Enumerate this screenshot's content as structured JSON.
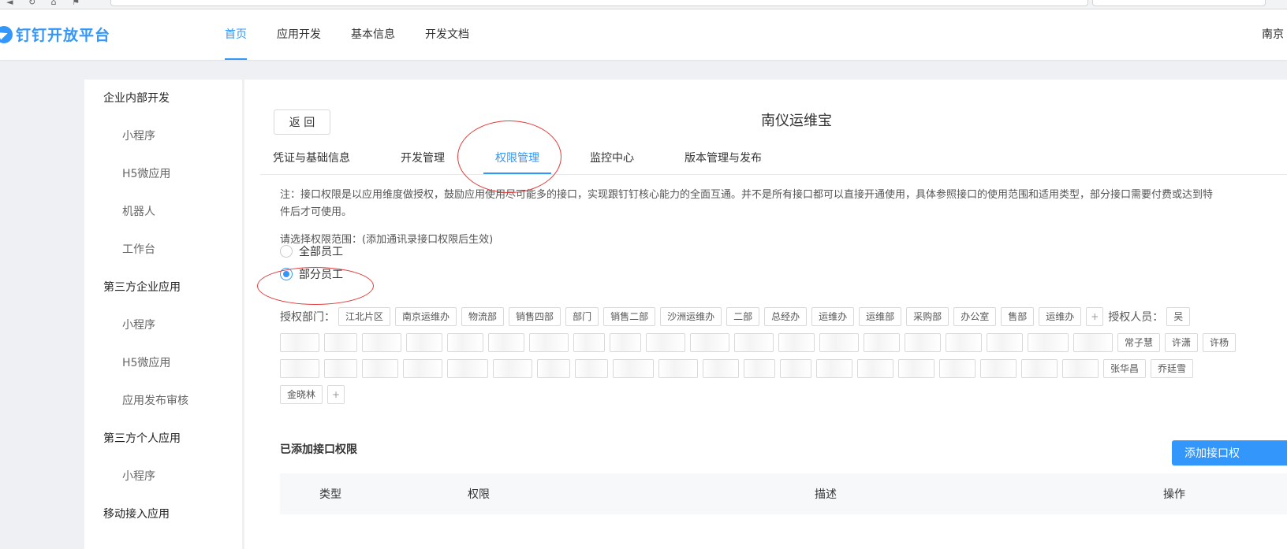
{
  "header": {
    "logo_text": "钉钉开放平台",
    "nav": [
      "首页",
      "应用开发",
      "基本信息",
      "开发文档"
    ],
    "active_nav": "首页",
    "user_text": "南京"
  },
  "sidebar": {
    "groups": [
      {
        "title": "企业内部开发",
        "items": [
          "小程序",
          "H5微应用",
          "机器人",
          "工作台"
        ]
      },
      {
        "title": "第三方企业应用",
        "items": [
          "小程序",
          "H5微应用",
          "应用发布审核"
        ]
      },
      {
        "title": "第三方个人应用",
        "items": [
          "小程序"
        ]
      },
      {
        "title": "移动接入应用",
        "items": []
      }
    ]
  },
  "main": {
    "back_label": "返 回",
    "app_title": "南仪运维宝",
    "tabs": [
      "凭证与基础信息",
      "开发管理",
      "权限管理",
      "监控中心",
      "版本管理与发布"
    ],
    "active_tab": "权限管理",
    "note_line1": "注：接口权限是以应用维度做授权，鼓励应用使用尽可能多的接口，实现跟钉钉核心能力的全面互通。并不是所有接口都可以直接开通使用，具体参照接口的使用范围和适用类型，部分接口需要付费或达到特",
    "note_line2": "件后才可使用。",
    "scope_label": "请选择权限范围：(添加通讯录接口权限后生效)",
    "radio_all": "全部员工",
    "radio_partial": "部分员工",
    "radio_selected": "部分员工",
    "auth_dept_label": "授权部门：",
    "auth_person_label": "授权人员：",
    "dept_chips_visible": [
      "江北片区",
      "南京运维办",
      "物流部",
      "销售四部",
      "部门",
      "销售二部",
      "沙洲运维办",
      "二部",
      "总经办",
      "运维办",
      "运维部",
      "采购部",
      "办公室",
      "售部",
      "运维办"
    ],
    "person_chips_row1": [
      "吴"
    ],
    "person_chips_row2_visible": [
      "常子慧",
      "许潇",
      "许杨"
    ],
    "person_chips_row3_visible": [
      "张华昌",
      "乔廷雪"
    ],
    "person_chips_row4_visible": [
      "金晓林"
    ],
    "added_title": "已添加接口权限",
    "add_button": "添加接口权",
    "table_headers": [
      "类型",
      "权限",
      "描述",
      "操作"
    ]
  }
}
